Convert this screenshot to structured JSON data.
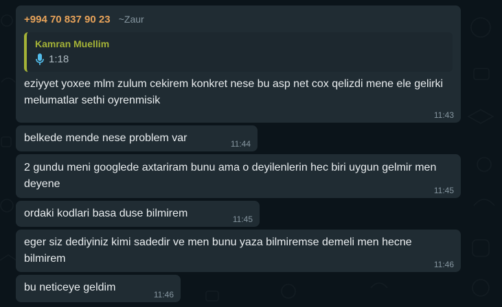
{
  "first_message": {
    "sender_phone": "+994 70 837 90 23",
    "sender_alias": "~Zaur",
    "quote": {
      "author": "Kamran Muellim",
      "duration": "1:18",
      "icon": "microphone-icon"
    },
    "text": "eziyyet yoxee mlm zulum cekirem konkret nese bu asp net cox qelizdi mene ele gelirki melumatlar sethi oyrenmisik",
    "time": "11:43"
  },
  "messages": [
    {
      "text": "belkede mende nese problem var",
      "time": "11:44"
    },
    {
      "text": "2 gundu meni googlede axtariram bunu ama o deyilenlerin hec biri uygun gelmir men deyene",
      "time": "11:45"
    },
    {
      "text": "ordaki kodlari basa duse bilmirem",
      "time": "11:45"
    },
    {
      "text": "eger siz dediyiniz kimi sadedir ve men bunu yaza bilmiremse demeli  men hecne bilmirem",
      "time": "11:46"
    },
    {
      "text": "bu neticeye geldim",
      "time": "11:46"
    }
  ],
  "colors": {
    "background": "#0b141a",
    "bubble": "#202c33",
    "sender_phone": "#e8a35a",
    "quote_accent": "#a5b337",
    "timestamp": "#8696a0",
    "mic_icon": "#53bdeb"
  }
}
